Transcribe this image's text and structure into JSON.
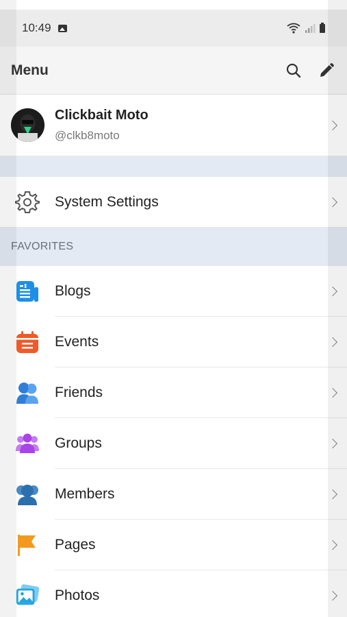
{
  "status_bar": {
    "time": "10:49",
    "icons": [
      "image-icon",
      "wifi-icon",
      "signal-icon",
      "battery-icon"
    ]
  },
  "header": {
    "title": "Menu",
    "actions": [
      "search-icon",
      "edit-pencil-icon"
    ]
  },
  "profile": {
    "name": "Clickbait Moto",
    "handle": "@clkb8moto"
  },
  "settings": {
    "label": "System Settings",
    "icon": "gear-icon"
  },
  "favorites": {
    "title": "FAVORITES",
    "items": [
      {
        "label": "Blogs",
        "icon": "blogs-icon",
        "color": "#1e8fe6"
      },
      {
        "label": "Events",
        "icon": "calendar-icon",
        "color": "#f05a28"
      },
      {
        "label": "Friends",
        "icon": "friends-icon",
        "color": "#2f7fd6"
      },
      {
        "label": "Groups",
        "icon": "groups-icon",
        "color": "#a844e8"
      },
      {
        "label": "Members",
        "icon": "members-icon",
        "color": "#2b6fae"
      },
      {
        "label": "Pages",
        "icon": "flag-icon",
        "color": "#f29a1f"
      },
      {
        "label": "Photos",
        "icon": "photos-icon",
        "color": "#22a6e0"
      }
    ]
  }
}
